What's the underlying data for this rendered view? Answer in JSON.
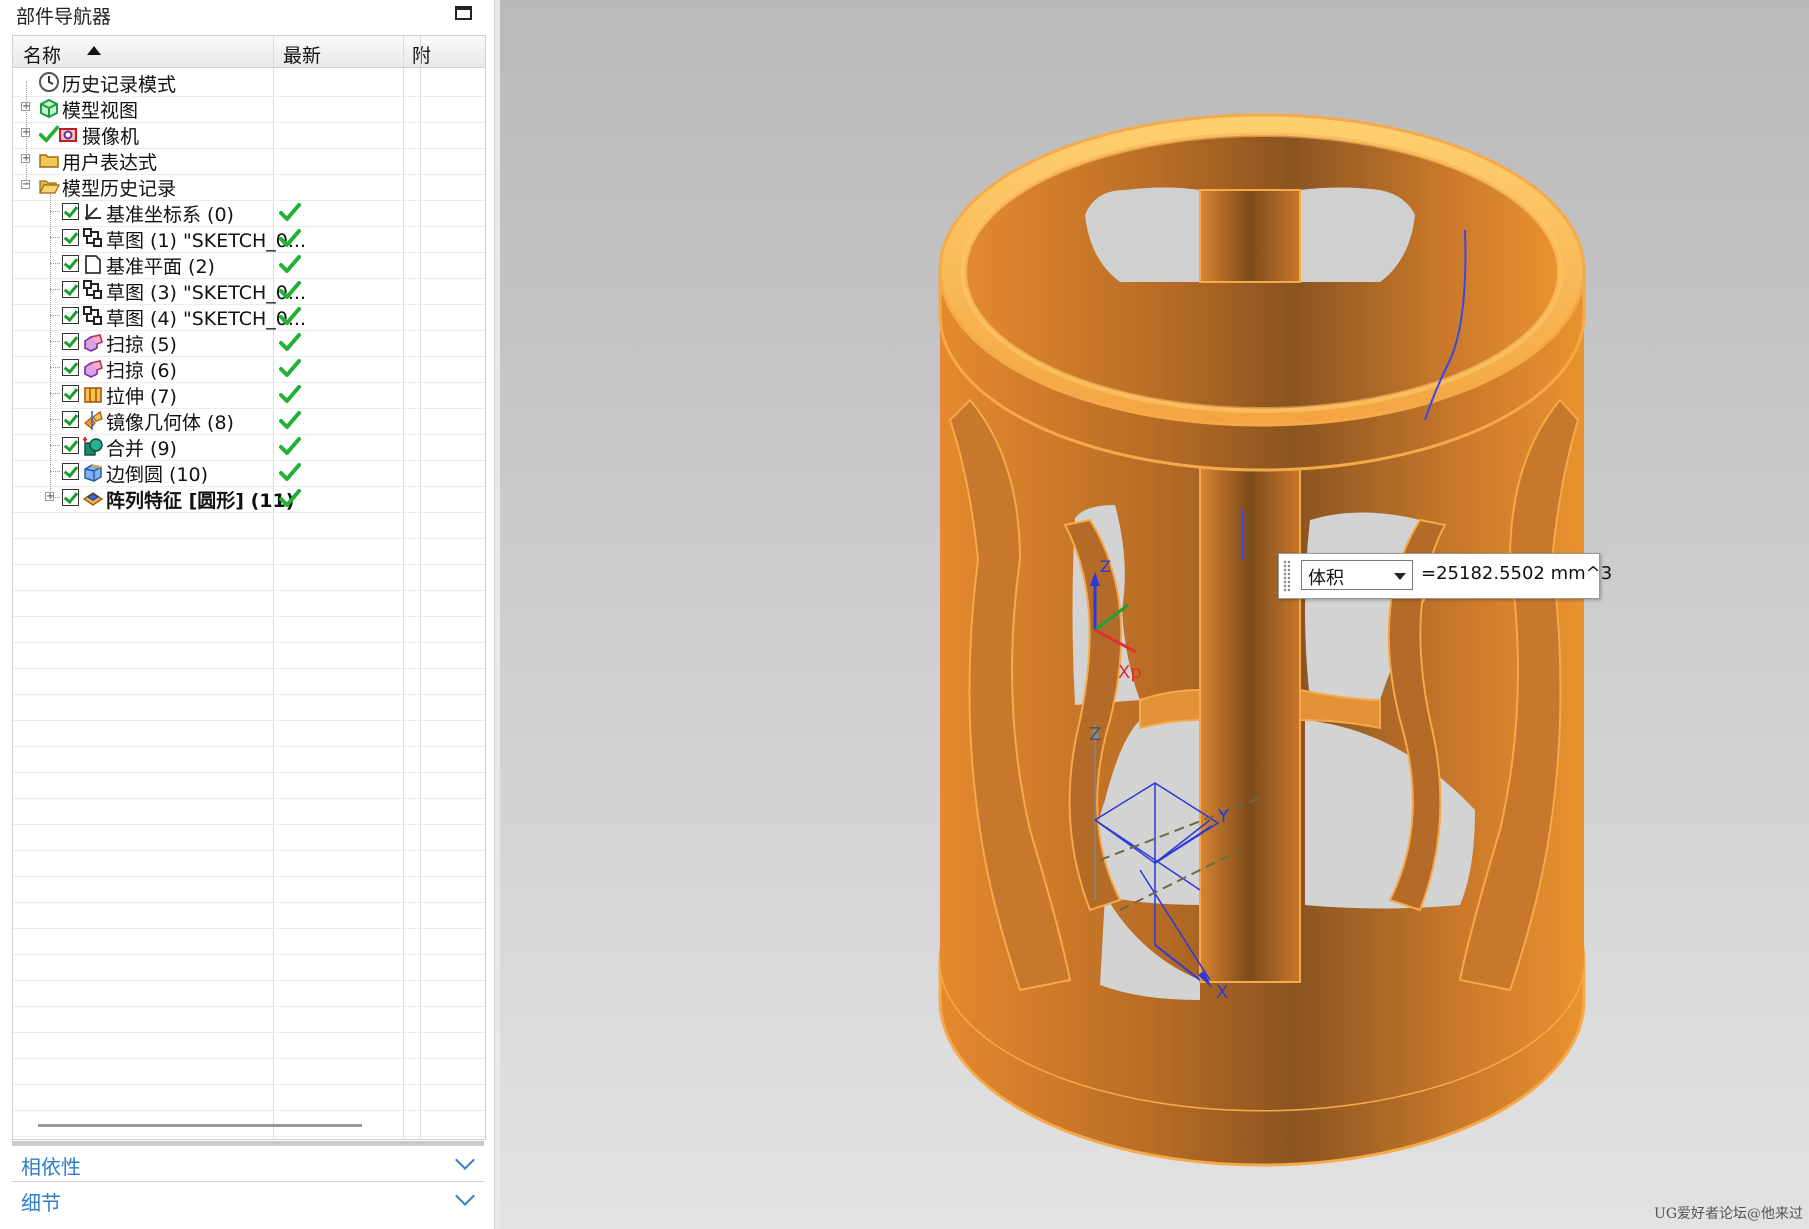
{
  "navigator": {
    "title": "部件导航器",
    "columns": {
      "name": "名称",
      "latest": "最新",
      "extra": "附"
    },
    "rows": [
      {
        "label": "历史记录模式",
        "icon": "clock-icon",
        "level": 0,
        "expander": "",
        "checkbox": false,
        "latest": false,
        "bold": false
      },
      {
        "label": "模型视图",
        "icon": "model-view-icon",
        "level": 0,
        "expander": "+",
        "checkbox": false,
        "latest": false,
        "bold": false
      },
      {
        "label": "摄像机",
        "icon": "camera-icon",
        "level": 0,
        "expander": "+",
        "checkbox": false,
        "latest": false,
        "bold": false,
        "status": "check-icon"
      },
      {
        "label": "用户表达式",
        "icon": "folder-icon",
        "level": 0,
        "expander": "+",
        "checkbox": false,
        "latest": false,
        "bold": false
      },
      {
        "label": "模型历史记录",
        "icon": "folder-open-icon",
        "level": 0,
        "expander": "−",
        "checkbox": false,
        "latest": false,
        "bold": false
      },
      {
        "label": "基准坐标系 (0)",
        "icon": "datum-csys-icon",
        "level": 1,
        "expander": "",
        "checkbox": true,
        "latest": true,
        "bold": false
      },
      {
        "label": "草图 (1) \"SKETCH_0...",
        "icon": "sketch-icon",
        "level": 1,
        "expander": "",
        "checkbox": true,
        "latest": true,
        "bold": false
      },
      {
        "label": "基准平面 (2)",
        "icon": "datum-plane-icon",
        "level": 1,
        "expander": "",
        "checkbox": true,
        "latest": true,
        "bold": false
      },
      {
        "label": "草图 (3) \"SKETCH_0...",
        "icon": "sketch-icon",
        "level": 1,
        "expander": "",
        "checkbox": true,
        "latest": true,
        "bold": false
      },
      {
        "label": "草图 (4) \"SKETCH_0...",
        "icon": "sketch-icon",
        "level": 1,
        "expander": "",
        "checkbox": true,
        "latest": true,
        "bold": false
      },
      {
        "label": "扫掠 (5)",
        "icon": "sweep-icon",
        "level": 1,
        "expander": "",
        "checkbox": true,
        "latest": true,
        "bold": false
      },
      {
        "label": "扫掠 (6)",
        "icon": "sweep-icon",
        "level": 1,
        "expander": "",
        "checkbox": true,
        "latest": true,
        "bold": false
      },
      {
        "label": "拉伸 (7)",
        "icon": "extrude-icon",
        "level": 1,
        "expander": "",
        "checkbox": true,
        "latest": true,
        "bold": false
      },
      {
        "label": "镜像几何体 (8)",
        "icon": "mirror-geometry-icon",
        "level": 1,
        "expander": "",
        "checkbox": true,
        "latest": true,
        "bold": false
      },
      {
        "label": "合并 (9)",
        "icon": "unite-icon",
        "level": 1,
        "expander": "",
        "checkbox": true,
        "latest": true,
        "bold": false
      },
      {
        "label": "边倒圆 (10)",
        "icon": "edge-blend-icon",
        "level": 1,
        "expander": "",
        "checkbox": true,
        "latest": true,
        "bold": false
      },
      {
        "label": "阵列特征 [圆形] (11)",
        "icon": "pattern-feature-icon",
        "level": 1,
        "expander": "+",
        "checkbox": true,
        "latest": true,
        "bold": true
      }
    ],
    "sections": [
      {
        "label": "相依性"
      },
      {
        "label": "细节"
      }
    ]
  },
  "viewport": {
    "model_color": "#f0a040",
    "background_top": "#b9b9b9",
    "background_bottom": "#e2e2e2",
    "axis_labels": {
      "zc_small": "Z",
      "xp": "Xp",
      "z": "Z",
      "x": "X",
      "y": "Y"
    }
  },
  "measure": {
    "type": "体积",
    "value": "=25182.5502 mm^3"
  },
  "watermark": "UG爱好者论坛@他来过"
}
